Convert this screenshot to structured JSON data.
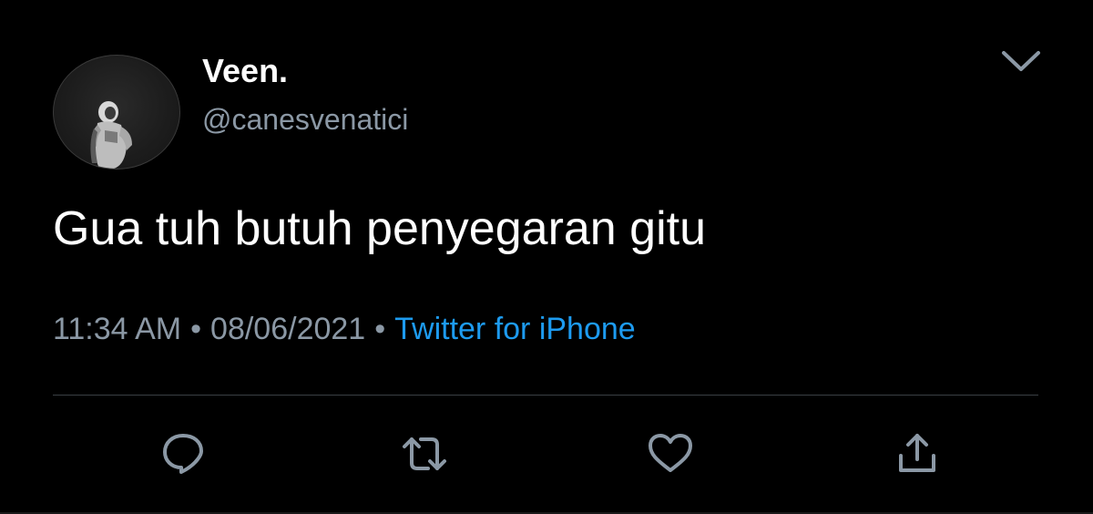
{
  "tweet": {
    "author": {
      "display_name": "Veen.",
      "handle": "@canesvenatici",
      "avatar": "astronaut-avatar"
    },
    "text": "Gua tuh butuh penyegaran gitu",
    "time": "11:34 AM",
    "separator": "•",
    "date": "08/06/2021",
    "source": "Twitter for iPhone",
    "menu_icon": "chevron-down-icon"
  },
  "actions": {
    "reply_icon": "reply-icon",
    "retweet_icon": "retweet-icon",
    "like_icon": "like-icon",
    "share_icon": "share-icon"
  },
  "colors": {
    "background": "#000000",
    "text": "#ffffff",
    "secondary": "#8b98a5",
    "link": "#1d9bf0",
    "divider": "#3a3f44"
  }
}
